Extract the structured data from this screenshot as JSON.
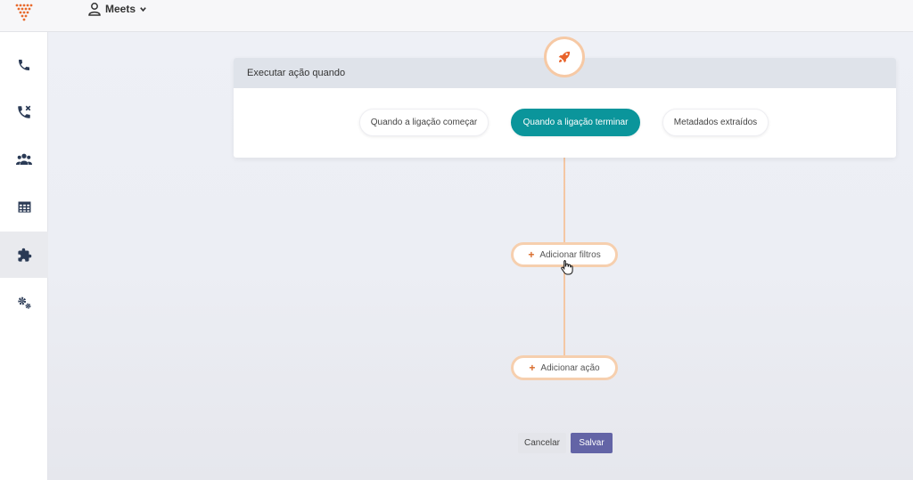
{
  "header": {
    "workspace_label": "Meets",
    "logo_icon": "dots-logo-icon",
    "user_icon": "user-icon",
    "dropdown_icon": "chevron-down-icon"
  },
  "sidebar": {
    "items": [
      {
        "icon": "phone-icon",
        "active": false
      },
      {
        "icon": "missed-call-icon",
        "active": false
      },
      {
        "icon": "users-icon",
        "active": false
      },
      {
        "icon": "table-icon",
        "active": false
      },
      {
        "icon": "puzzle-icon",
        "active": true
      },
      {
        "icon": "gears-icon",
        "active": false
      }
    ]
  },
  "trigger": {
    "icon": "rocket-icon",
    "title": "Executar ação quando",
    "options": [
      {
        "label": "Quando a ligação começar",
        "selected": false
      },
      {
        "label": "Quando a ligação terminar",
        "selected": true
      },
      {
        "label": "Metadados extraídos",
        "selected": false
      }
    ]
  },
  "flow": {
    "add_filters_label": "Adicionar filtros",
    "add_action_label": "Adicionar ação"
  },
  "footer": {
    "cancel_label": "Cancelar",
    "save_label": "Salvar"
  },
  "colors": {
    "accent_teal": "#0b959b",
    "save_purple": "#6364a6",
    "flow_orange": "#f6cfae",
    "plus_orange": "#d86a2a"
  }
}
